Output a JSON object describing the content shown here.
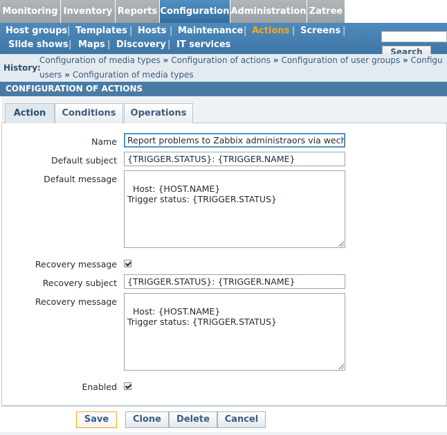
{
  "top_nav": {
    "tabs": [
      {
        "label": "Monitoring",
        "active": false
      },
      {
        "label": "Inventory",
        "active": false
      },
      {
        "label": "Reports",
        "active": false
      },
      {
        "label": "Configuration",
        "active": true
      },
      {
        "label": "Administration",
        "active": false
      },
      {
        "label": "Zatree",
        "active": false
      }
    ]
  },
  "sub_nav": {
    "row1": [
      "Host groups",
      "Templates",
      "Hosts",
      "Maintenance",
      "Actions",
      "Screens"
    ],
    "row2": [
      "Slide shows",
      "Maps",
      "Discovery",
      "IT services"
    ],
    "active": "Actions",
    "separator": "|"
  },
  "search": {
    "value": "",
    "button_label": "Search"
  },
  "history": {
    "label": "History:",
    "line1": [
      "Configuration of media types",
      "Configuration of actions",
      "Configuration of user groups",
      "Configu"
    ],
    "line2": [
      "users",
      "Configuration of media types"
    ],
    "arrow": "»"
  },
  "section_title": "CONFIGURATION OF ACTIONS",
  "form_tabs": [
    {
      "label": "Action",
      "active": true
    },
    {
      "label": "Conditions",
      "active": false
    },
    {
      "label": "Operations",
      "active": false
    }
  ],
  "form": {
    "name_label": "Name",
    "name_value": "Report problems to Zabbix administraors via wechat",
    "default_subject_label": "Default subject",
    "default_subject_value": "{TRIGGER.STATUS}: {TRIGGER.NAME}",
    "default_message_label": "Default message",
    "default_message_value": "Host: {HOST.NAME}\nTrigger status: {TRIGGER.STATUS}",
    "recovery_checkbox_label": "Recovery message",
    "recovery_checked": true,
    "recovery_subject_label": "Recovery subject",
    "recovery_subject_value": "{TRIGGER.STATUS}: {TRIGGER.NAME}",
    "recovery_message_label": "Recovery message",
    "recovery_message_value": "Host: {HOST.NAME}\nTrigger status: {TRIGGER.STATUS}",
    "enabled_label": "Enabled",
    "enabled_checked": true
  },
  "buttons": {
    "save": "Save",
    "clone": "Clone",
    "delete": "Delete",
    "cancel": "Cancel"
  },
  "colors": {
    "active_tab": "#3f7aab",
    "inactive_tab": "#a4a9ac",
    "subnav_bg": "#4680b0",
    "active_subnav_text": "#f6a91a",
    "section_header": "#4a7ba5"
  }
}
